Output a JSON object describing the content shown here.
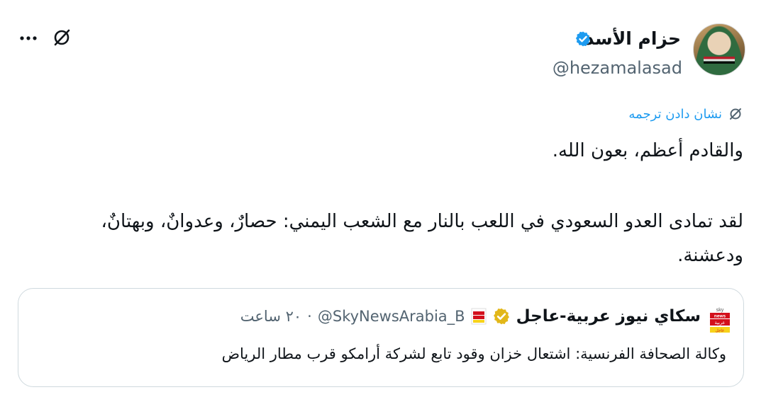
{
  "author": {
    "display_name": "حزام الأسد",
    "handle": "@hezamalasad"
  },
  "translate_label": "نشان دادن ترجمه",
  "tweet": {
    "line1": "والقادم أعظم، بعون الله.",
    "line2": "لقد تمادى العدو السعودي في اللعب بالنار مع الشعب اليمني: حصارٌ، وعدوانٌ، وبهتانٌ،",
    "line3": "ودعشنة."
  },
  "quoted": {
    "display_name": "سكاي نيوز عربية-عاجل",
    "handle": "@SkyNewsArabia_B",
    "time_ago": "۲۰ ساعت",
    "separator": "·",
    "text": "وكالة الصحافة الفرنسية: اشتعال خزان وقود تابع لشركة أرامكو قرب مطار الرياض",
    "logo_text": "sky news عربية"
  },
  "icons": {
    "verified": "verified-blue-badge",
    "verified_gold": "verified-gold-badge",
    "grok": "grok-icon",
    "more": "more-icon",
    "translate": "translate-icon"
  },
  "colors": {
    "accent": "#1d9bf0",
    "secondary_text": "#536471",
    "gold": "#e2b719",
    "border": "#cfd9de"
  }
}
